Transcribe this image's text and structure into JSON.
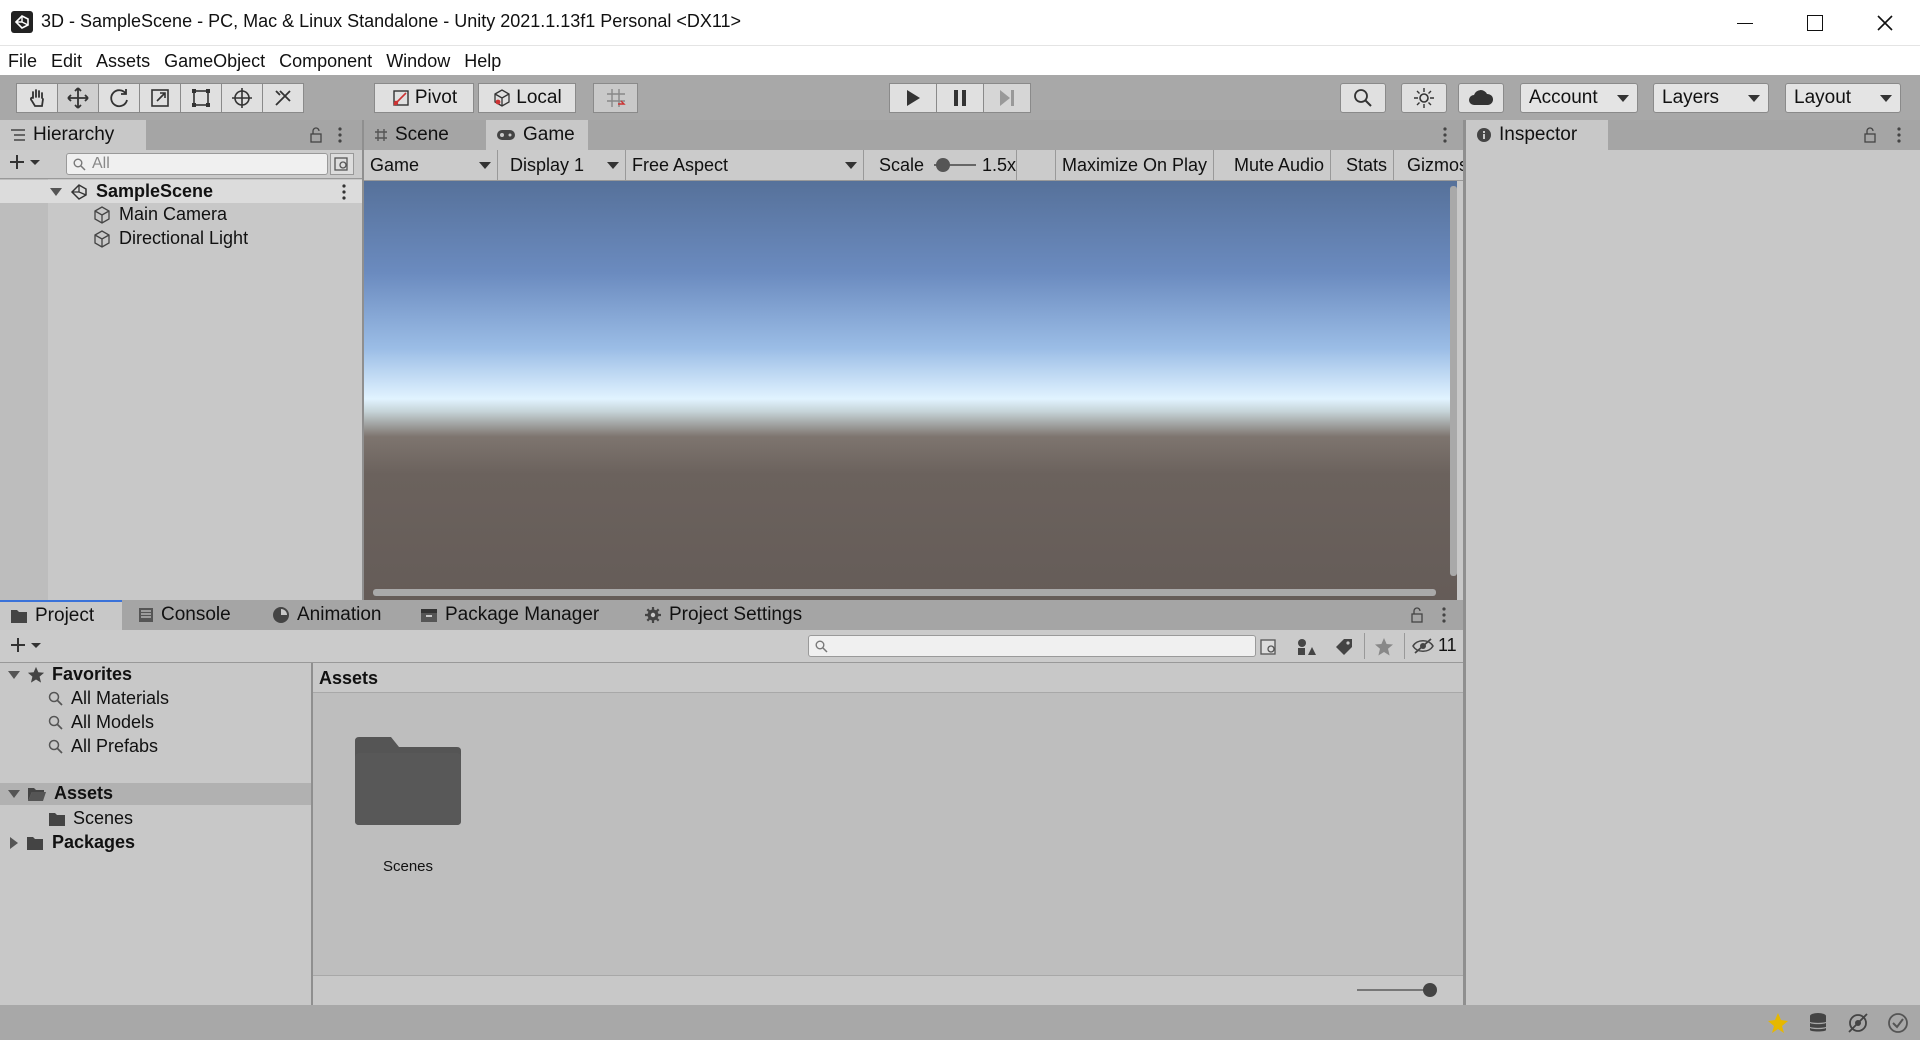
{
  "window": {
    "title": "3D - SampleScene - PC, Mac & Linux Standalone - Unity 2021.1.13f1 Personal <DX11>"
  },
  "menu": [
    "File",
    "Edit",
    "Assets",
    "GameObject",
    "Component",
    "Window",
    "Help"
  ],
  "toolbar": {
    "tools": [
      "hand-tool",
      "move-tool",
      "rotate-tool",
      "scale-tool",
      "rect-tool",
      "transform-tool",
      "custom-tool"
    ],
    "pivot_label": "Pivot",
    "local_label": "Local",
    "account_label": "Account",
    "layers_label": "Layers",
    "layout_label": "Layout"
  },
  "hierarchy": {
    "tab_label": "Hierarchy",
    "search_placeholder": "All",
    "scene_name": "SampleScene",
    "objects": [
      "Main Camera",
      "Directional Light"
    ]
  },
  "center": {
    "tabs": [
      "Scene",
      "Game"
    ],
    "active_tab": "Game",
    "game_dropdown": "Game",
    "display_dropdown": "Display 1",
    "aspect_dropdown": "Free Aspect",
    "scale_label": "Scale",
    "scale_value": "1.5x",
    "maximize_label": "Maximize On Play",
    "mute_label": "Mute Audio",
    "stats_label": "Stats",
    "gizmos_label": "Gizmos"
  },
  "inspector": {
    "tab_label": "Inspector"
  },
  "bottom": {
    "tabs": [
      "Project",
      "Console",
      "Animation",
      "Package Manager",
      "Project Settings"
    ],
    "hidden_count": "11",
    "favorites_label": "Favorites",
    "favorites": [
      "All Materials",
      "All Models",
      "All Prefabs"
    ],
    "assets_label": "Assets",
    "assets_children": [
      "Scenes"
    ],
    "packages_label": "Packages",
    "breadcrumb": "Assets",
    "grid_items": [
      "Scenes"
    ]
  }
}
